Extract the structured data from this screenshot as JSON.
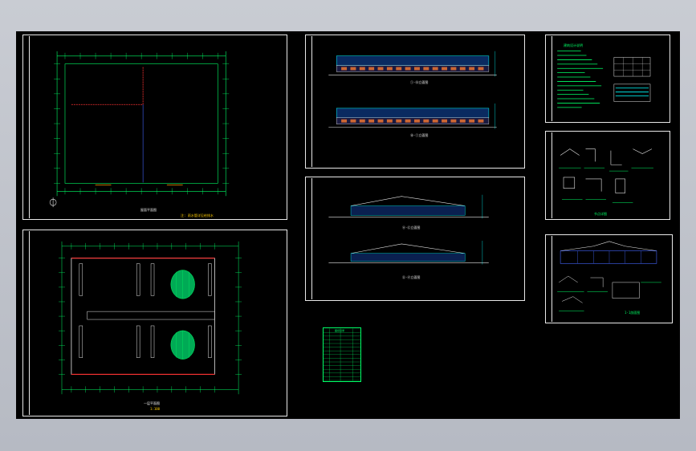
{
  "viewer": {
    "background": "#000000",
    "frame_color": "#e8e8e8",
    "grid_color": "#00ff66",
    "dim_color": "#00ffff",
    "wall_color": "#ff3333",
    "fill_color": "#00aa55"
  },
  "sheets": [
    {
      "id": "roof-plan",
      "caption": "屋面平面图",
      "note": "注: 雨水管详见给排水"
    },
    {
      "id": "floor-plan",
      "caption": "一层平面图",
      "note": "1:100"
    },
    {
      "id": "elevations-front",
      "caption_a": "①-⑩立面图",
      "caption_b": "⑩-①立面图"
    },
    {
      "id": "elevations-side",
      "caption_a": "Ⓐ-Ⓖ立面图",
      "caption_b": "Ⓖ-Ⓐ立面图"
    },
    {
      "id": "design-notes",
      "caption": "建筑设计说明"
    },
    {
      "id": "details",
      "caption": "节点详图"
    },
    {
      "id": "section",
      "caption": "1-1剖面图"
    },
    {
      "id": "drawing-index",
      "caption": "图纸目录"
    }
  ]
}
